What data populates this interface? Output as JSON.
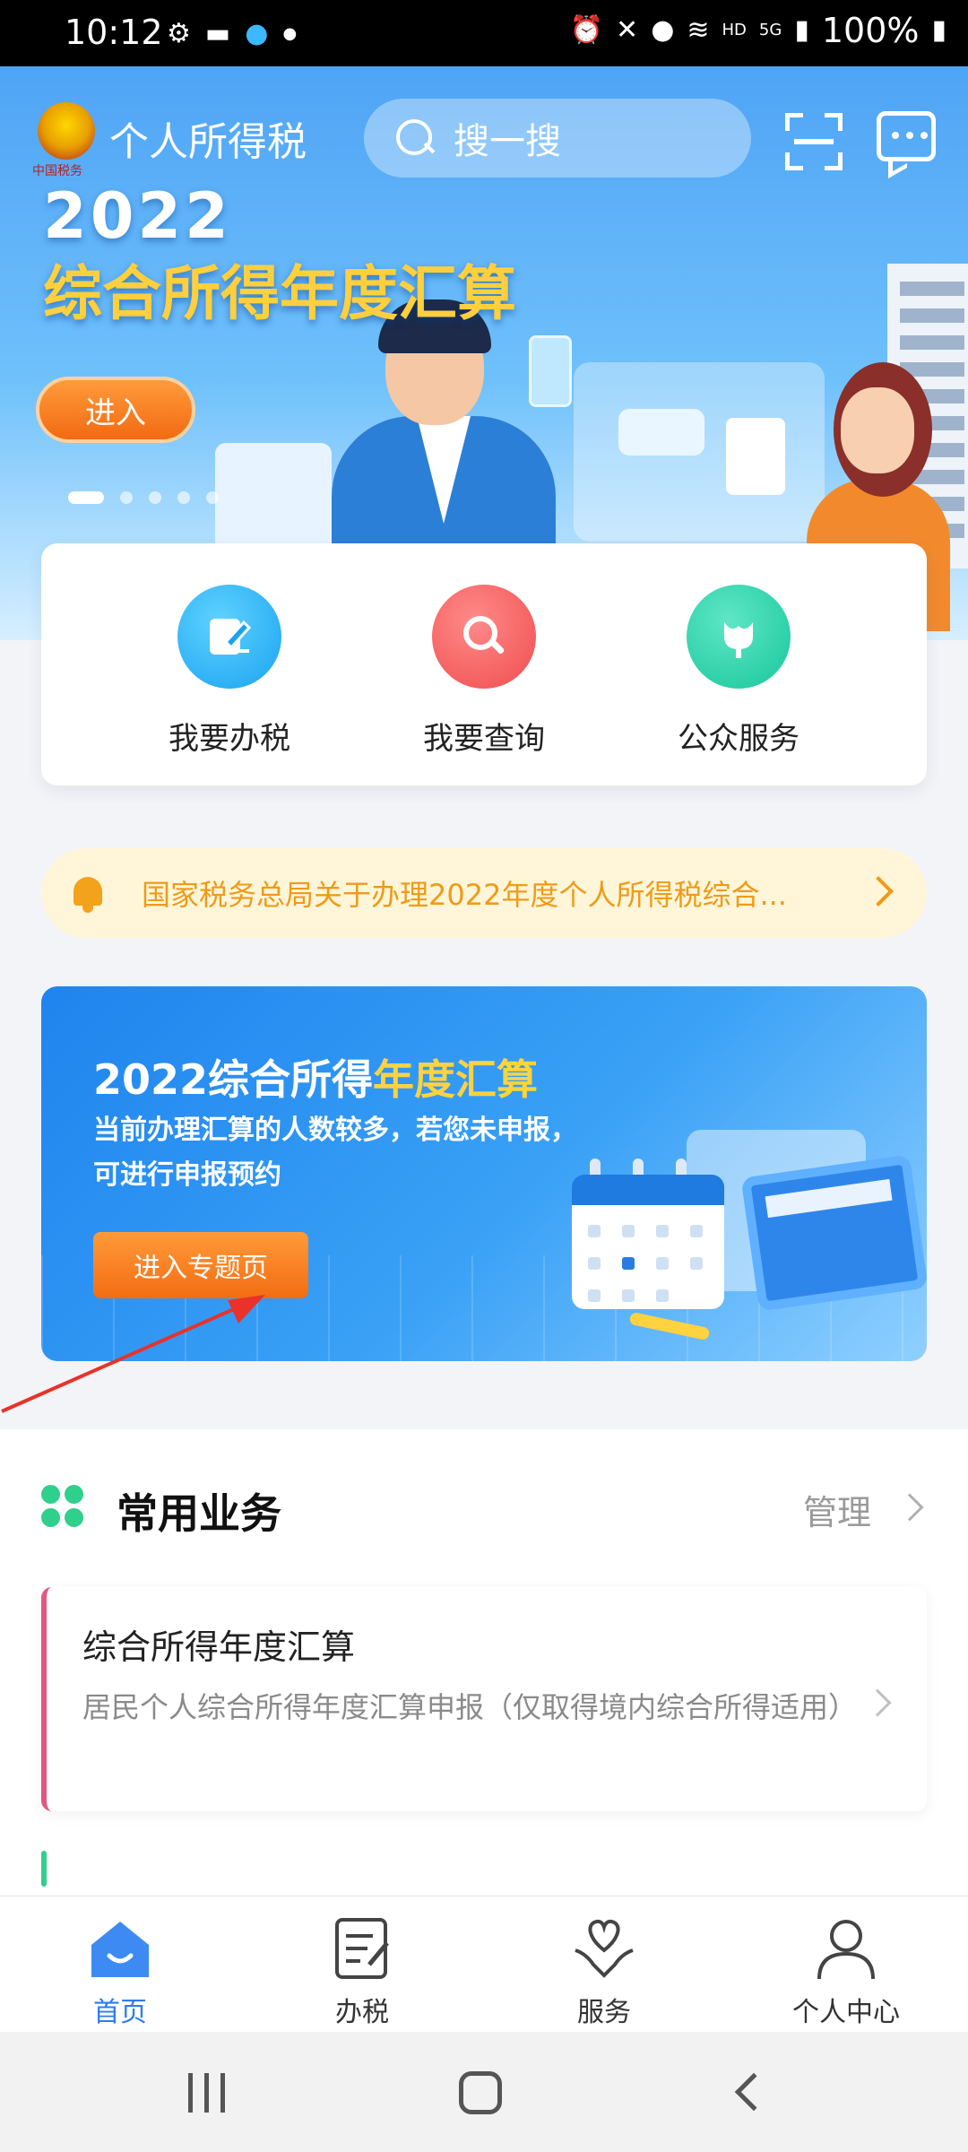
{
  "status_bar": {
    "time": "10:12",
    "network": "HD",
    "signal": "5G",
    "battery": "100%"
  },
  "header": {
    "app_title": "个人所得税",
    "emblem_text": "中国税务",
    "search_placeholder": "搜一搜",
    "icons": [
      "scan-icon",
      "message-icon"
    ]
  },
  "hero_banner": {
    "year": "2022",
    "title": "综合所得年度汇算",
    "button": "进入",
    "page_indicator": {
      "total": 5,
      "active": 1
    }
  },
  "quick_actions": [
    {
      "label": "我要办税",
      "icon": "pen-edit-icon",
      "color": "#1aa3f0"
    },
    {
      "label": "我要查询",
      "icon": "magnifier-icon",
      "color": "#f04d4d"
    },
    {
      "label": "公众服务",
      "icon": "tulip-icon",
      "color": "#17c79a"
    }
  ],
  "notice": {
    "icon": "bell-icon",
    "text": "国家税务总局关于办理2022年度个人所得税综合..."
  },
  "promo": {
    "title_prefix": "2022综合所得",
    "title_highlight": "年度汇算",
    "description": "当前办理汇算的人数较多，若您未申报，可进行申报预约",
    "button": "进入专题页"
  },
  "common_business": {
    "title": "常用业务",
    "manage": "管理",
    "items": [
      {
        "title": "综合所得年度汇算",
        "description": "居民个人综合所得年度汇算申报（仅取得境内综合所得适用）"
      }
    ]
  },
  "tab_bar": {
    "tabs": [
      {
        "label": "首页",
        "icon": "home-icon",
        "active": true
      },
      {
        "label": "办税",
        "icon": "document-edit-icon",
        "active": false
      },
      {
        "label": "服务",
        "icon": "heart-hands-icon",
        "active": false
      },
      {
        "label": "个人中心",
        "icon": "person-icon",
        "active": false
      }
    ]
  },
  "colors": {
    "accent": "#2d7cf0",
    "orange": "#f36d12",
    "notice_text": "#f09a18",
    "green": "#2fcf8c"
  }
}
